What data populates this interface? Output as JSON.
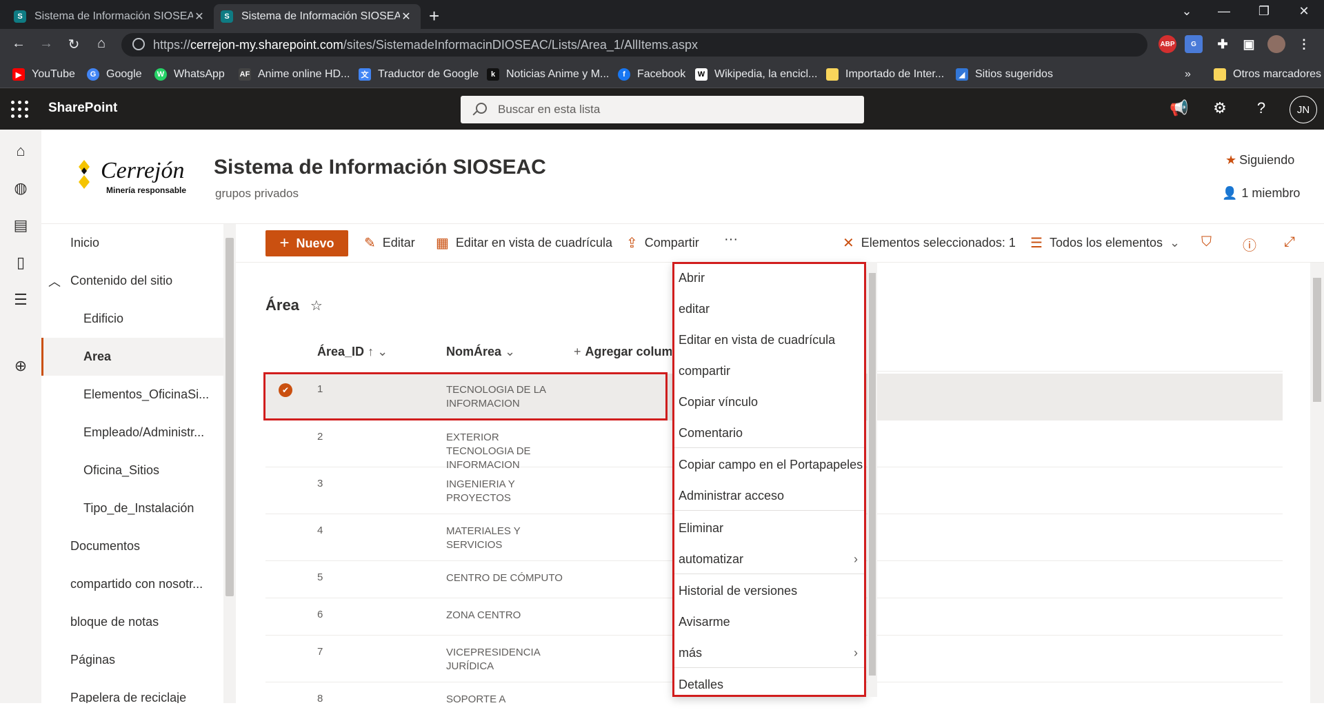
{
  "browser": {
    "tabs": [
      {
        "title": "Sistema de Información SIOSEAC",
        "favicon": "S"
      },
      {
        "title": "Sistema de Información SIOSEAC",
        "favicon": "S"
      }
    ],
    "url_prefix": "https://",
    "url_host": "cerrejon-my.sharepoint.com",
    "url_path": "/sites/SistemadeInformacinDIOSEAC/Lists/Area_1/AllItems.aspx",
    "extensions": [
      "ABP",
      "G"
    ],
    "bookmarks": [
      {
        "label": "YouTube",
        "icon": "youtube-icon",
        "color": "#ff0000",
        "glyph": "▶"
      },
      {
        "label": "Google",
        "icon": "google-icon",
        "color": "#4285f4",
        "glyph": "G"
      },
      {
        "label": "WhatsApp",
        "icon": "whatsapp-icon",
        "color": "#25d366",
        "glyph": "W"
      },
      {
        "label": "Anime online HD...",
        "icon": "animeflv-icon",
        "color": "#333333",
        "glyph": "AF"
      },
      {
        "label": "Traductor de Google",
        "icon": "translate-icon",
        "color": "#4285f4",
        "glyph": "文"
      },
      {
        "label": "Noticias Anime y M...",
        "icon": "kudasai-icon",
        "color": "#111111",
        "glyph": "k"
      },
      {
        "label": "Facebook",
        "icon": "facebook-icon",
        "color": "#1877f2",
        "glyph": "f"
      },
      {
        "label": "Wikipedia, la encicl...",
        "icon": "wikipedia-icon",
        "color": "#ffffff",
        "glyph": "W"
      },
      {
        "label": "Importado de Inter...",
        "icon": "folder-icon",
        "color": "#f9d55b",
        "glyph": ""
      },
      {
        "label": "Sitios sugeridos",
        "icon": "edge-icon",
        "color": "#3277d8",
        "glyph": "◢"
      }
    ],
    "more_bookmarks": "»",
    "other_bookmarks": "Otros marcadores"
  },
  "suite": {
    "brand": "SharePoint",
    "search_placeholder": "Buscar en esta lista",
    "avatar_initials": "JN"
  },
  "site": {
    "logo_text": "Cerrejón",
    "logo_tagline": "Minería responsable",
    "title": "Sistema de Información SIOSEAC",
    "subtitle": "grupos privados",
    "follow_label": "Siguiendo",
    "members_label": "1 miembro"
  },
  "leftnav": [
    {
      "label": "Inicio",
      "indent": 0
    },
    {
      "label": "Contenido del sitio",
      "indent": 0,
      "chevron": "︿"
    },
    {
      "label": "Edificio",
      "indent": 1
    },
    {
      "label": "Area",
      "indent": 1,
      "selected": true
    },
    {
      "label": "Elementos_OficinaSi...",
      "indent": 1
    },
    {
      "label": "Empleado/Administr...",
      "indent": 1
    },
    {
      "label": "Oficina_Sitios",
      "indent": 1
    },
    {
      "label": "Tipo_de_Instalación",
      "indent": 1
    },
    {
      "label": "Documentos",
      "indent": 0
    },
    {
      "label": "compartido con nosotr...",
      "indent": 0
    },
    {
      "label": "bloque de notas",
      "indent": 0
    },
    {
      "label": "Páginas",
      "indent": 0
    },
    {
      "label": "Papelera de reciclaje",
      "indent": 0
    }
  ],
  "commandbar": {
    "new_label": "Nuevo",
    "edit_label": "Editar",
    "grid_edit_label": "Editar en vista de cuadrícula",
    "share_label": "Compartir",
    "more_label": "···",
    "selected_label": "Elementos seleccionados: 1",
    "view_label": "Todos los elementos"
  },
  "list": {
    "title": "Área",
    "columns": {
      "id": "Área_ID",
      "sort_arrow": "↑",
      "name": "NomÁrea",
      "add": "Agregar columna"
    },
    "rows": [
      {
        "id": "1",
        "name": "TECNOLOGIA DE LA INFORMACION",
        "selected": true
      },
      {
        "id": "2",
        "name": "EXTERIOR TECNOLOGIA DE INFORMACION"
      },
      {
        "id": "3",
        "name": "INGENIERIA Y PROYECTOS"
      },
      {
        "id": "4",
        "name": "MATERIALES Y SERVICIOS"
      },
      {
        "id": "5",
        "name": "CENTRO DE CÓMPUTO"
      },
      {
        "id": "6",
        "name": "ZONA CENTRO"
      },
      {
        "id": "7",
        "name": "VICEPRESIDENCIA JURÍDICA"
      },
      {
        "id": "8",
        "name": "SOPORTE A"
      }
    ]
  },
  "contextmenu": [
    {
      "label": "Abrir"
    },
    {
      "label": "editar"
    },
    {
      "label": "Editar en vista de cuadrícula"
    },
    {
      "label": "compartir"
    },
    {
      "label": "Copiar vínculo"
    },
    {
      "label": "Comentario"
    },
    {
      "label": "Copiar campo en el Portapapeles"
    },
    {
      "label": "Administrar acceso"
    },
    {
      "label": "Eliminar"
    },
    {
      "label": "automatizar",
      "submenu": true
    },
    {
      "label": "Historial de versiones"
    },
    {
      "label": "Avisarme"
    },
    {
      "label": "más",
      "submenu": true
    },
    {
      "label": "Detalles"
    }
  ],
  "colors": {
    "accent": "#ca5010",
    "highlight_border": "#d11d1d",
    "suite_bg": "#201f1e"
  }
}
